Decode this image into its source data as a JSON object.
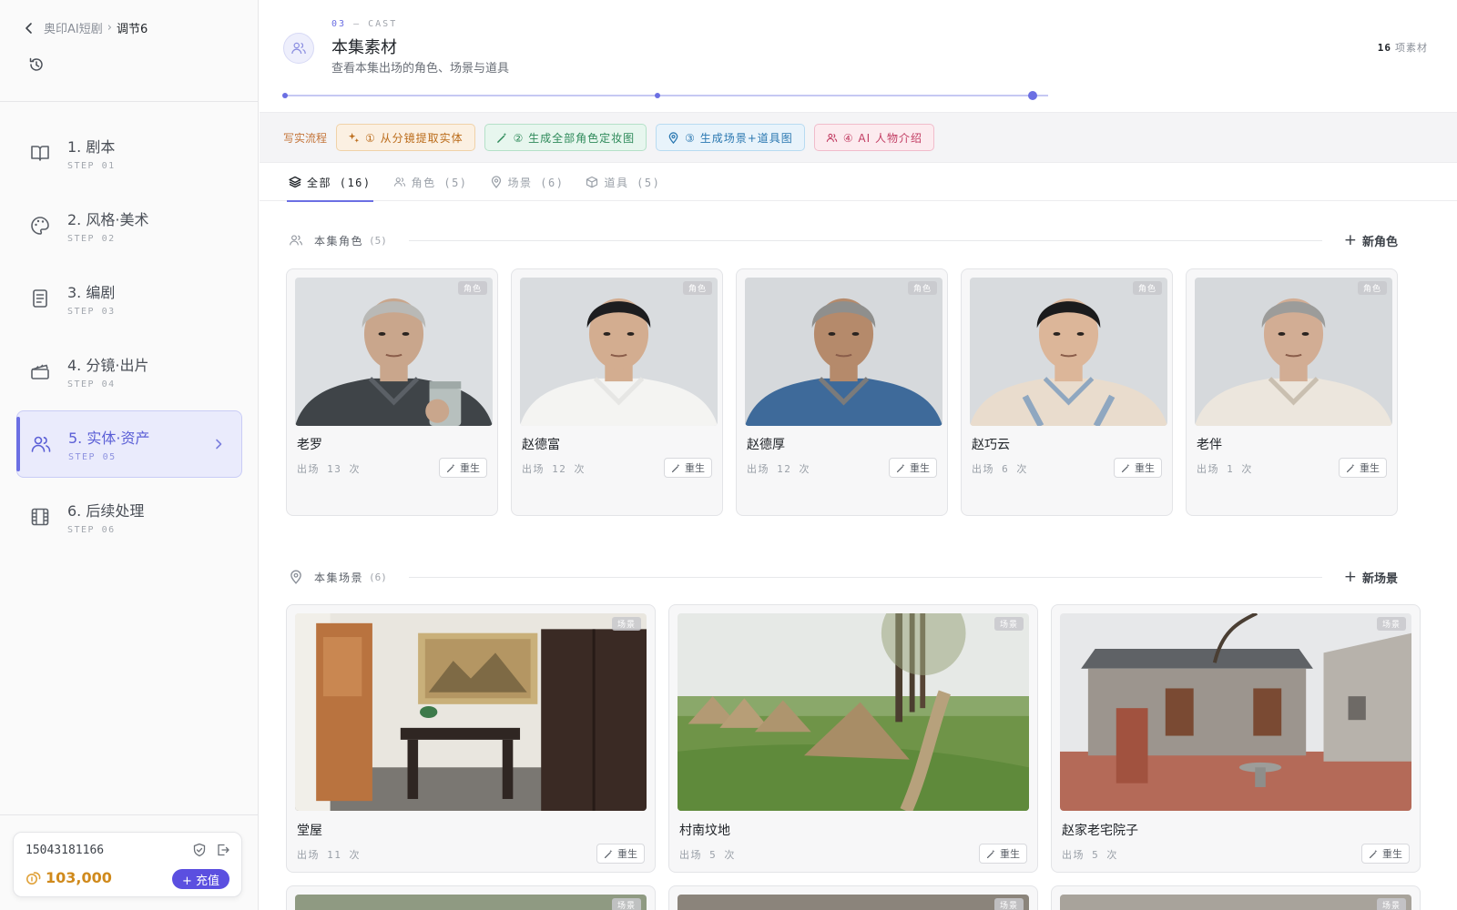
{
  "breadcrumb": {
    "root": "奥印AI短剧",
    "separator": "›",
    "current": "调节6"
  },
  "steps": [
    {
      "title": "1. 剧本",
      "code": "STEP 01",
      "icon": "book-icon"
    },
    {
      "title": "2. 风格·美术",
      "code": "STEP 02",
      "icon": "palette-icon"
    },
    {
      "title": "3. 编剧",
      "code": "STEP 03",
      "icon": "document-icon"
    },
    {
      "title": "4. 分镜·出片",
      "code": "STEP 04",
      "icon": "clapperboard-icon"
    },
    {
      "title": "5. 实体·资产",
      "code": "STEP 05",
      "icon": "users-icon",
      "active": true
    },
    {
      "title": "6. 后续处理",
      "code": "STEP 06",
      "icon": "film-icon"
    }
  ],
  "account": {
    "phone": "15043181166",
    "balance": "103,000",
    "recharge_label": "+ 充值"
  },
  "header": {
    "kicker_num": "03",
    "kicker_dash": "—",
    "kicker_text": "CAST",
    "title": "本集素材",
    "subtitle": "查看本集出场的角色、场景与道具",
    "count_num": "16",
    "count_label": "项素材"
  },
  "flow": {
    "label": "写实流程",
    "chips": [
      {
        "label": "① 从分镜提取实体"
      },
      {
        "label": "② 生成全部角色定妆图"
      },
      {
        "label": "③ 生成场景+道具图"
      },
      {
        "label": "④ AI 人物介绍"
      }
    ]
  },
  "tabs": [
    {
      "label": "全部 (16)",
      "active": true
    },
    {
      "label": "角色 (5)"
    },
    {
      "label": "场景 (6)"
    },
    {
      "label": "道具 (5)"
    }
  ],
  "characters": {
    "title": "本集角色",
    "count": "(5)",
    "add_label": "新角色",
    "badge": "角色",
    "items": [
      {
        "name": "老罗",
        "appear": "出场 13 次"
      },
      {
        "name": "赵德富",
        "appear": "出场 12 次"
      },
      {
        "name": "赵德厚",
        "appear": "出场 12 次"
      },
      {
        "name": "赵巧云",
        "appear": "出场 6 次"
      },
      {
        "name": "老伴",
        "appear": "出场 1 次"
      }
    ]
  },
  "scenes": {
    "title": "本集场景",
    "count": "(6)",
    "add_label": "新场景",
    "badge": "场景",
    "items": [
      {
        "name": "堂屋",
        "appear": "出场 11 次"
      },
      {
        "name": "村南坟地",
        "appear": "出场 5 次"
      },
      {
        "name": "赵家老宅院子",
        "appear": "出场 5 次"
      }
    ]
  },
  "regen_label": "重生",
  "colors": {
    "accent": "#6b6fe3",
    "recharge": "#5b4fe0",
    "balance": "#d08a1c"
  }
}
